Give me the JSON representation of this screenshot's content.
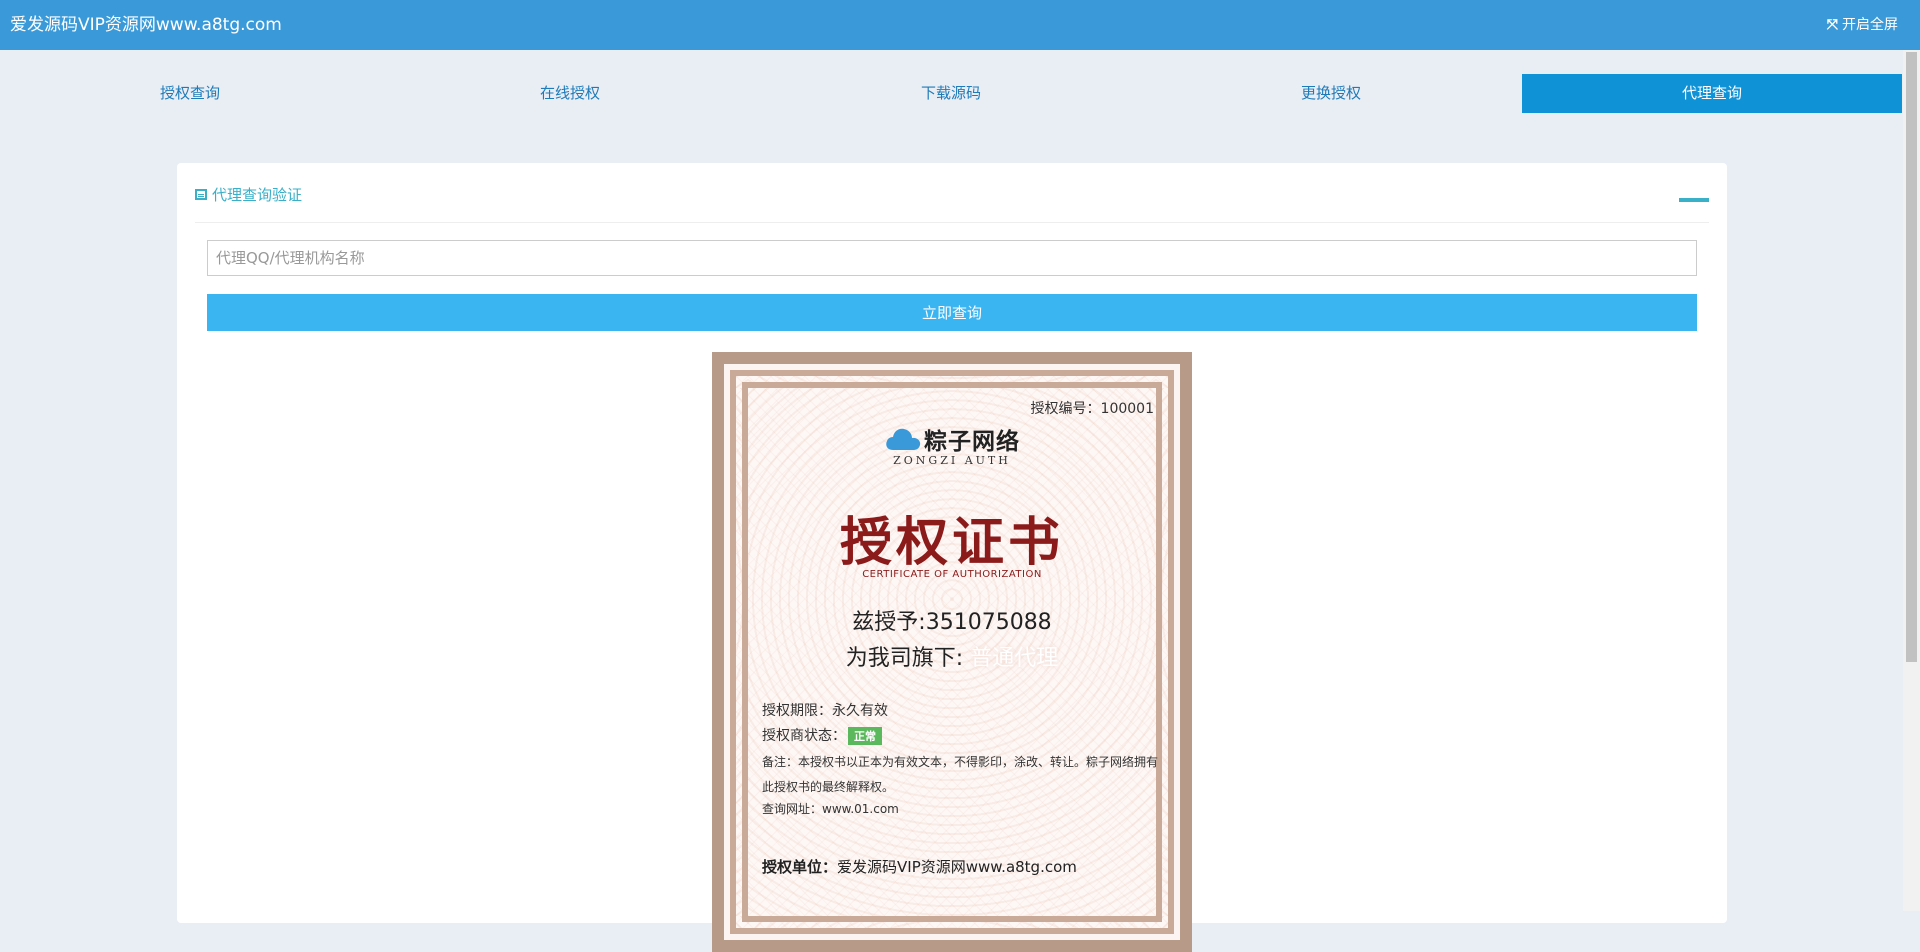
{
  "header": {
    "title": "爱发源码VIP资源网www.a8tg.com",
    "fullscreen_label": "开启全屏",
    "fullscreen_icon": "expand-icon"
  },
  "tabs": [
    {
      "label": "授权查询",
      "active": false
    },
    {
      "label": "在线授权",
      "active": false
    },
    {
      "label": "下载源码",
      "active": false
    },
    {
      "label": "更换授权",
      "active": false
    },
    {
      "label": "代理查询",
      "active": true
    }
  ],
  "panel": {
    "title": "代理查询验证",
    "title_icon": "list-icon",
    "search_placeholder": "代理QQ/代理机构名称",
    "search_value": "",
    "query_button": "立即查询"
  },
  "certificate": {
    "number": "授权编号：100001",
    "logo_text": "粽子网络",
    "logo_subtext": "ZONGZI AUTH",
    "title": "授权证书",
    "subtitle": "CERTIFICATE OF AUTHORIZATION",
    "grant_to": "兹授予:351075088",
    "grant_under_prefix": "为我司旗下:",
    "grant_under_agency": "普通代理",
    "period": "授权期限：永久有效",
    "status_label": "授权商状态：",
    "status_value": "正常",
    "note": "备注：本授权书以正本为有效文本，不得影印，涂改、转让。粽子网络拥有此授权书的最终解释权。",
    "query_url": "查询网址：www.01.com",
    "unit_label": "授权单位：",
    "unit_value": "爱发源码VIP资源网www.a8tg.com"
  },
  "colors": {
    "header_bg": "#3a9ad9",
    "active_tab": "#1092d6",
    "button": "#3bb4f2",
    "accent": "#3ab0c8",
    "cert_title": "#8b1a1a",
    "status_badge": "#5cb85c"
  }
}
